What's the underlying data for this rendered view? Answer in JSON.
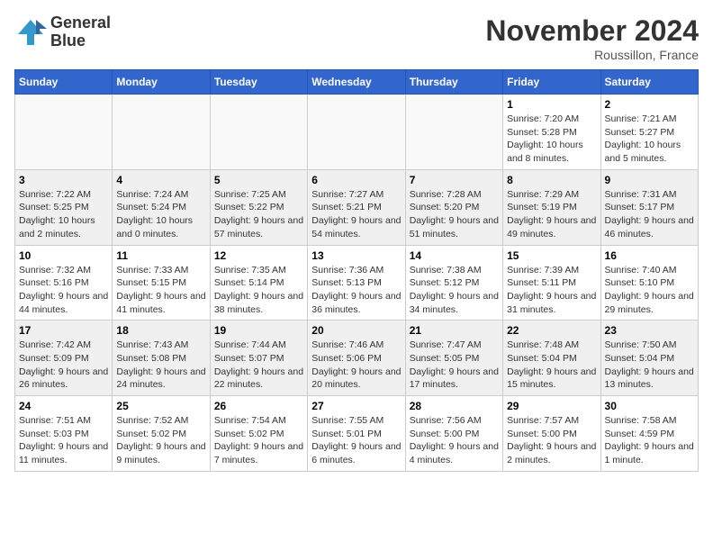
{
  "header": {
    "logo_line1": "General",
    "logo_line2": "Blue",
    "month": "November 2024",
    "location": "Roussillon, France"
  },
  "days_of_week": [
    "Sunday",
    "Monday",
    "Tuesday",
    "Wednesday",
    "Thursday",
    "Friday",
    "Saturday"
  ],
  "weeks": [
    [
      {
        "day": "",
        "empty": true
      },
      {
        "day": "",
        "empty": true
      },
      {
        "day": "",
        "empty": true
      },
      {
        "day": "",
        "empty": true
      },
      {
        "day": "",
        "empty": true
      },
      {
        "day": "1",
        "info": "Sunrise: 7:20 AM\nSunset: 5:28 PM\nDaylight: 10 hours and 8 minutes."
      },
      {
        "day": "2",
        "info": "Sunrise: 7:21 AM\nSunset: 5:27 PM\nDaylight: 10 hours and 5 minutes."
      }
    ],
    [
      {
        "day": "3",
        "info": "Sunrise: 7:22 AM\nSunset: 5:25 PM\nDaylight: 10 hours and 2 minutes.",
        "shaded": true
      },
      {
        "day": "4",
        "info": "Sunrise: 7:24 AM\nSunset: 5:24 PM\nDaylight: 10 hours and 0 minutes.",
        "shaded": true
      },
      {
        "day": "5",
        "info": "Sunrise: 7:25 AM\nSunset: 5:22 PM\nDaylight: 9 hours and 57 minutes.",
        "shaded": true
      },
      {
        "day": "6",
        "info": "Sunrise: 7:27 AM\nSunset: 5:21 PM\nDaylight: 9 hours and 54 minutes.",
        "shaded": true
      },
      {
        "day": "7",
        "info": "Sunrise: 7:28 AM\nSunset: 5:20 PM\nDaylight: 9 hours and 51 minutes.",
        "shaded": true
      },
      {
        "day": "8",
        "info": "Sunrise: 7:29 AM\nSunset: 5:19 PM\nDaylight: 9 hours and 49 minutes.",
        "shaded": true
      },
      {
        "day": "9",
        "info": "Sunrise: 7:31 AM\nSunset: 5:17 PM\nDaylight: 9 hours and 46 minutes.",
        "shaded": true
      }
    ],
    [
      {
        "day": "10",
        "info": "Sunrise: 7:32 AM\nSunset: 5:16 PM\nDaylight: 9 hours and 44 minutes."
      },
      {
        "day": "11",
        "info": "Sunrise: 7:33 AM\nSunset: 5:15 PM\nDaylight: 9 hours and 41 minutes."
      },
      {
        "day": "12",
        "info": "Sunrise: 7:35 AM\nSunset: 5:14 PM\nDaylight: 9 hours and 38 minutes."
      },
      {
        "day": "13",
        "info": "Sunrise: 7:36 AM\nSunset: 5:13 PM\nDaylight: 9 hours and 36 minutes."
      },
      {
        "day": "14",
        "info": "Sunrise: 7:38 AM\nSunset: 5:12 PM\nDaylight: 9 hours and 34 minutes."
      },
      {
        "day": "15",
        "info": "Sunrise: 7:39 AM\nSunset: 5:11 PM\nDaylight: 9 hours and 31 minutes."
      },
      {
        "day": "16",
        "info": "Sunrise: 7:40 AM\nSunset: 5:10 PM\nDaylight: 9 hours and 29 minutes."
      }
    ],
    [
      {
        "day": "17",
        "info": "Sunrise: 7:42 AM\nSunset: 5:09 PM\nDaylight: 9 hours and 26 minutes.",
        "shaded": true
      },
      {
        "day": "18",
        "info": "Sunrise: 7:43 AM\nSunset: 5:08 PM\nDaylight: 9 hours and 24 minutes.",
        "shaded": true
      },
      {
        "day": "19",
        "info": "Sunrise: 7:44 AM\nSunset: 5:07 PM\nDaylight: 9 hours and 22 minutes.",
        "shaded": true
      },
      {
        "day": "20",
        "info": "Sunrise: 7:46 AM\nSunset: 5:06 PM\nDaylight: 9 hours and 20 minutes.",
        "shaded": true
      },
      {
        "day": "21",
        "info": "Sunrise: 7:47 AM\nSunset: 5:05 PM\nDaylight: 9 hours and 17 minutes.",
        "shaded": true
      },
      {
        "day": "22",
        "info": "Sunrise: 7:48 AM\nSunset: 5:04 PM\nDaylight: 9 hours and 15 minutes.",
        "shaded": true
      },
      {
        "day": "23",
        "info": "Sunrise: 7:50 AM\nSunset: 5:04 PM\nDaylight: 9 hours and 13 minutes.",
        "shaded": true
      }
    ],
    [
      {
        "day": "24",
        "info": "Sunrise: 7:51 AM\nSunset: 5:03 PM\nDaylight: 9 hours and 11 minutes."
      },
      {
        "day": "25",
        "info": "Sunrise: 7:52 AM\nSunset: 5:02 PM\nDaylight: 9 hours and 9 minutes."
      },
      {
        "day": "26",
        "info": "Sunrise: 7:54 AM\nSunset: 5:02 PM\nDaylight: 9 hours and 7 minutes."
      },
      {
        "day": "27",
        "info": "Sunrise: 7:55 AM\nSunset: 5:01 PM\nDaylight: 9 hours and 6 minutes."
      },
      {
        "day": "28",
        "info": "Sunrise: 7:56 AM\nSunset: 5:00 PM\nDaylight: 9 hours and 4 minutes."
      },
      {
        "day": "29",
        "info": "Sunrise: 7:57 AM\nSunset: 5:00 PM\nDaylight: 9 hours and 2 minutes."
      },
      {
        "day": "30",
        "info": "Sunrise: 7:58 AM\nSunset: 4:59 PM\nDaylight: 9 hours and 1 minute."
      }
    ]
  ]
}
